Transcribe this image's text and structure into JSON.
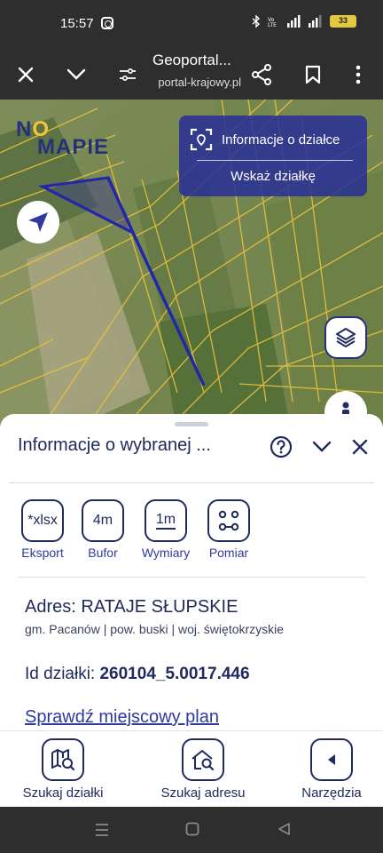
{
  "status_bar": {
    "time": "15:57",
    "network": "LTE",
    "battery": "33"
  },
  "browser": {
    "close_icon": "close-icon",
    "title": "Geoportal...",
    "url": "portal-krajowy.pl"
  },
  "map": {
    "logo_text_a": "N",
    "logo_text_o": "O",
    "logo_text_b": "MAPIE",
    "info_button_label": "Informacje o działce",
    "select_plot_label": "Wskaż działkę"
  },
  "sheet": {
    "title": "Informacje o wybranej ...",
    "tools": [
      {
        "icon_text": "*xlsx",
        "label": "Eksport"
      },
      {
        "icon_text": "4m",
        "label": "Bufor"
      },
      {
        "icon_text": "1m",
        "label": "Wymiary"
      },
      {
        "icon_text": "",
        "label": "Pomiar"
      }
    ],
    "address": "Adres: RATAJE SŁUPSKIE",
    "address_sub": "gm. Pacanów | pow. buski | woj. świętokrzyskie",
    "plot_id_label": "Id działki:",
    "plot_id_value": "260104_5.0017.446",
    "plan_link": "Sprawdź miejscowy plan"
  },
  "bottom_nav": [
    {
      "label": "Szukaj działki"
    },
    {
      "label": "Szukaj adresu"
    },
    {
      "label": "Narzędzia"
    }
  ],
  "colors": {
    "brand": "#202a5c",
    "accent": "#2f3aa0",
    "card": "#282e96",
    "parcel_lines": "#e8c23a"
  }
}
